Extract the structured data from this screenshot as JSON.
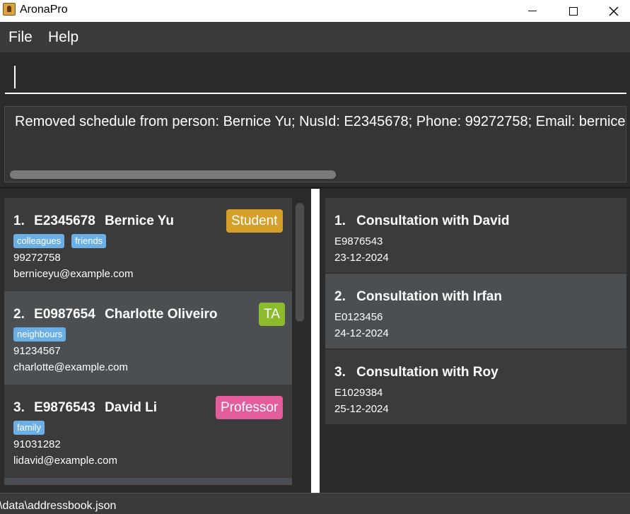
{
  "window": {
    "title": "AronaPro"
  },
  "menu": {
    "file": "File",
    "help": "Help"
  },
  "command": {
    "value": "",
    "placeholder": ""
  },
  "result": {
    "text": "Removed schedule from person: Bernice Yu; NusId: E2345678; Phone: 99272758; Email: berniceyu@example.com"
  },
  "persons": [
    {
      "index": "1.",
      "nusid": "E2345678",
      "name": "Bernice Yu",
      "role": "Student",
      "role_color": "#d4a02a",
      "tags": [
        "colleagues",
        "friends"
      ],
      "phone": "99272758",
      "email": "berniceyu@example.com"
    },
    {
      "index": "2.",
      "nusid": "E0987654",
      "name": "Charlotte Oliveiro",
      "role": "TA",
      "role_color": "#8dbb2e",
      "tags": [
        "neighbours"
      ],
      "phone": "91234567",
      "email": "charlotte@example.com"
    },
    {
      "index": "3.",
      "nusid": "E9876543",
      "name": "David Li",
      "role": "Professor",
      "role_color": "#e35c9c",
      "tags": [
        "family"
      ],
      "phone": "91031282",
      "email": "lidavid@example.com"
    }
  ],
  "schedules": [
    {
      "index": "1.",
      "title": "Consultation with David",
      "nusid": "E9876543",
      "date": "23-12-2024"
    },
    {
      "index": "2.",
      "title": "Consultation with Irfan",
      "nusid": "E0123456",
      "date": "24-12-2024"
    },
    {
      "index": "3.",
      "title": "Consultation with Roy",
      "nusid": "E1029384",
      "date": "25-12-2024"
    }
  ],
  "status": {
    "path": "\\data\\addressbook.json"
  }
}
